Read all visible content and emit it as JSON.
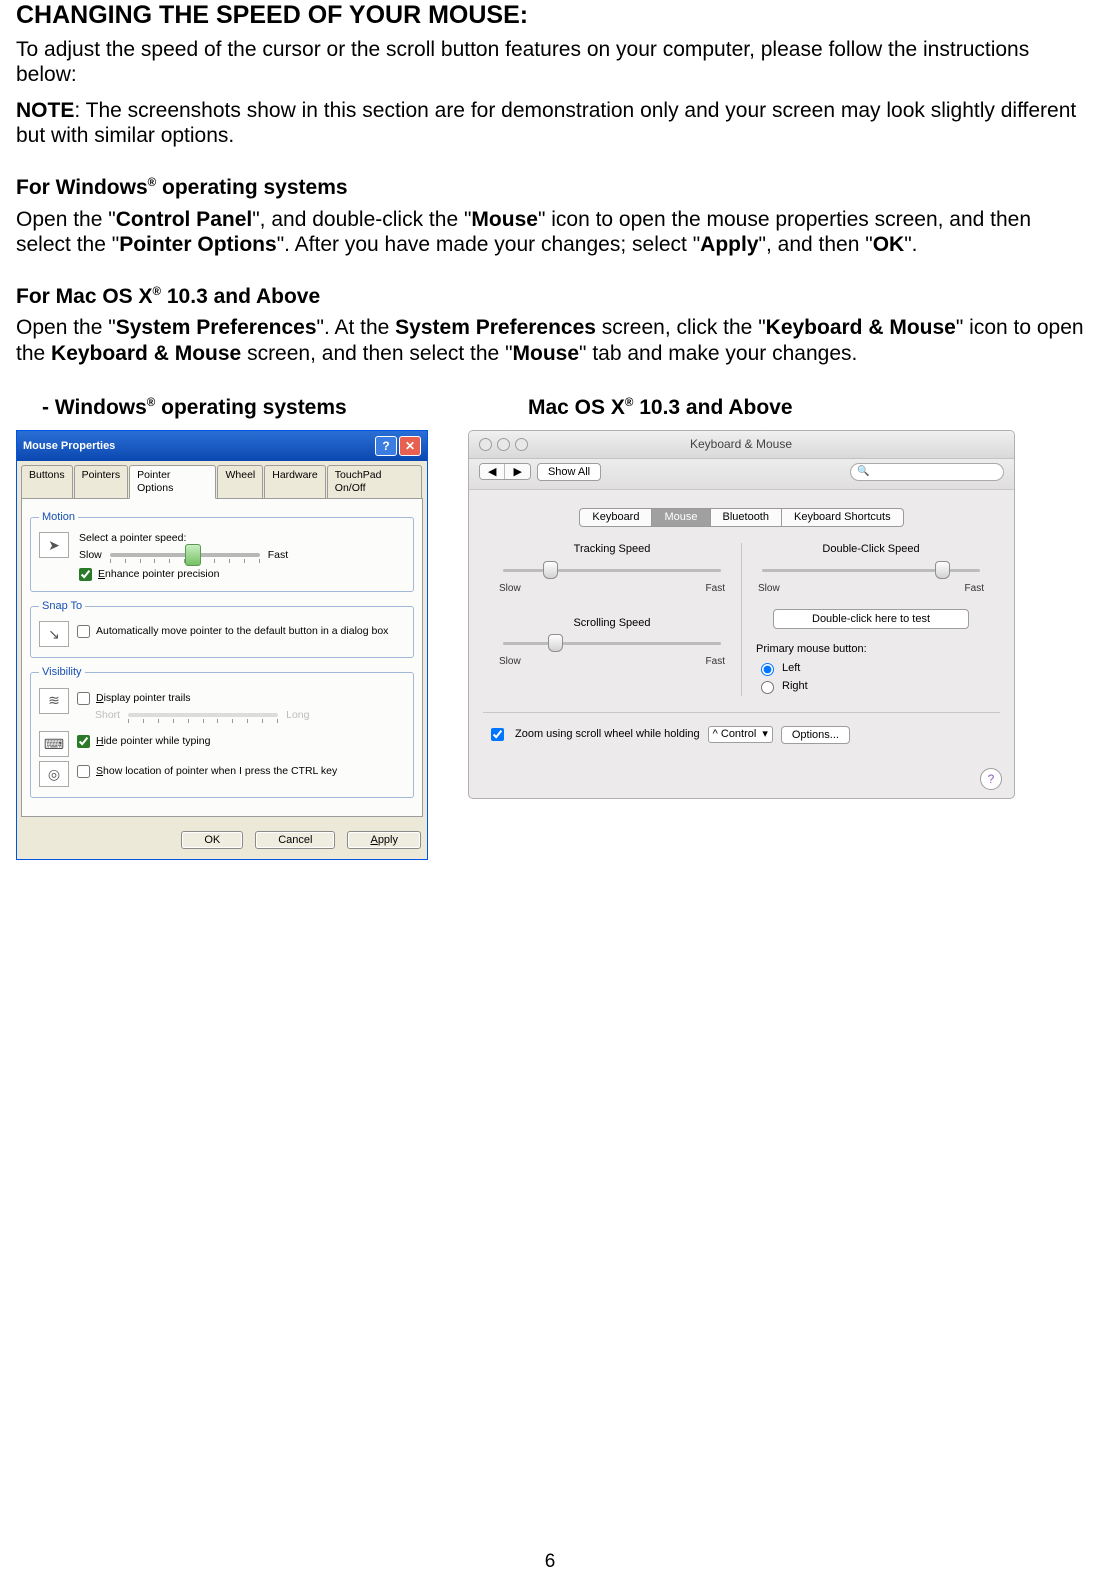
{
  "title": "CHANGING THE SPEED OF YOUR MOUSE:",
  "intro": "To adjust the speed of the cursor or the scroll button features on your computer, please follow the instructions below:",
  "note_prefix": "NOTE",
  "note_body": ": The screenshots show in this section are for demonstration only and your screen may look slightly different but with similar options.",
  "win_heading_pre": "For Windows",
  "win_heading_post": " operating systems",
  "win_para_parts": {
    "a": "Open the \"",
    "b": "Control Panel",
    "c": "\", and double-click the \"",
    "d": "Mouse",
    "e": "\" icon to open the mouse properties screen, and then select the \"",
    "f": "Pointer Options",
    "g": "\". After you have made your changes; select \"",
    "h": "Apply",
    "i": "\", and then \"",
    "j": "OK",
    "k": "\"."
  },
  "mac_heading_pre": "For Mac OS X",
  "mac_heading_post": " 10.3 and Above",
  "mac_para_parts": {
    "a": "Open the \"",
    "b": "System Preferences",
    "c": "\". At the ",
    "d": "System Preferences",
    "e": " screen, click the \"",
    "f": "Keyboard & Mouse",
    "g": "\" icon to open the ",
    "h": "Keyboard & Mouse",
    "i": " screen, and then select the \"",
    "j": "Mouse",
    "k": "\" tab and make your changes."
  },
  "col_win_pre": "-    Windows",
  "col_win_post": " operating systems",
  "col_mac_pre": "Mac OS X",
  "col_mac_post": " 10.3 and Above",
  "pageNumber": "6",
  "winDialog": {
    "title": "Mouse Properties",
    "helpGlyph": "?",
    "closeGlyph": "✕",
    "tabs": [
      "Buttons",
      "Pointers",
      "Pointer Options",
      "Wheel",
      "Hardware",
      "TouchPad On/Off"
    ],
    "activeTab": 2,
    "motion": {
      "legend": "Motion",
      "label": "Select a pointer speed:",
      "slow": "Slow",
      "fast": "Fast",
      "enhance": "Enhance pointer precision",
      "enhanceChecked": true,
      "thumbPct": 50
    },
    "snap": {
      "legend": "Snap To",
      "text": "Automatically move pointer to the default button in a dialog box",
      "checked": false
    },
    "vis": {
      "legend": "Visibility",
      "trails": "Display pointer trails",
      "trailsChecked": false,
      "short": "Short",
      "long": "Long",
      "hide": "Hide pointer while typing",
      "hideChecked": true,
      "ctrl": "Show location of pointer when I press the CTRL key",
      "ctrlChecked": false
    },
    "buttons": {
      "ok": "OK",
      "cancel": "Cancel",
      "apply": "Apply"
    }
  },
  "macDialog": {
    "title": "Keyboard & Mouse",
    "back": "◀",
    "fwd": "▶",
    "showAll": "Show All",
    "searchGlyph": "🔍",
    "tabs": [
      "Keyboard",
      "Mouse",
      "Bluetooth",
      "Keyboard Shortcuts"
    ],
    "activeTab": 1,
    "tracking": {
      "label": "Tracking Speed",
      "slow": "Slow",
      "fast": "Fast",
      "thumbPct": 20
    },
    "doubleClick": {
      "label": "Double-Click Speed",
      "slow": "Slow",
      "fast": "Fast",
      "thumbPct": 78,
      "test": "Double-click here to test"
    },
    "scrolling": {
      "label": "Scrolling Speed",
      "slow": "Slow",
      "fast": "Fast",
      "thumbPct": 22
    },
    "primary": {
      "label": "Primary mouse button:",
      "left": "Left",
      "right": "Right",
      "selected": "left"
    },
    "zoom": {
      "checked": true,
      "text": "Zoom using scroll wheel while holding",
      "modifier": "^ Control",
      "dropGlyph": "▾",
      "options": "Options..."
    },
    "helpGlyph": "?"
  }
}
